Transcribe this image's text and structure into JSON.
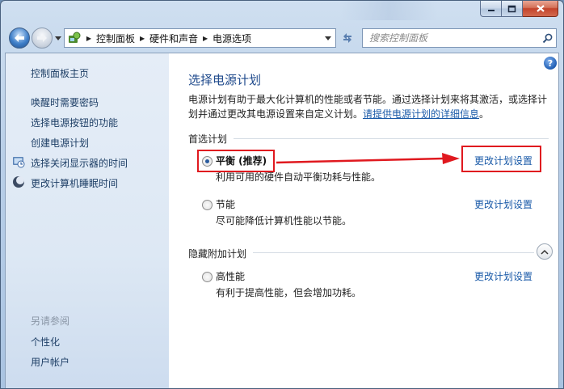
{
  "window": {
    "title_blur": ""
  },
  "address": {
    "crumbs": [
      "控制面板",
      "硬件和声音",
      "电源选项"
    ]
  },
  "search": {
    "placeholder": "搜索控制面板"
  },
  "sidebar": {
    "home": "控制面板主页",
    "tasks": [
      "唤醒时需要密码",
      "选择电源按钮的功能",
      "创建电源计划",
      "选择关闭显示器的时间",
      "更改计算机睡眠时间"
    ],
    "see_also_heading": "另请参阅",
    "see_also": [
      "个性化",
      "用户帐户"
    ]
  },
  "main": {
    "help": "?",
    "title": "选择电源计划",
    "desc_text": "电源计划有助于最大化计算机的性能或者节能。通过选择计划来将其激活，或选择计划并通过更改其电源设置来自定义计划。",
    "desc_link": "请提供电源计划的详细信息",
    "desc_end": "。",
    "preferred_label": "首选计划",
    "hidden_label": "隐藏附加计划",
    "change_label": "更改计划设置",
    "plans": [
      {
        "name": "平衡 (推荐)",
        "desc": "利用可用的硬件自动平衡功耗与性能。",
        "selected": true
      },
      {
        "name": "节能",
        "desc": "尽可能降低计算机性能以节能。",
        "selected": false
      },
      {
        "name": "高性能",
        "desc": "有利于提高性能，但会增加功耗。",
        "selected": false
      }
    ]
  },
  "annotation_color": "#e0191f"
}
